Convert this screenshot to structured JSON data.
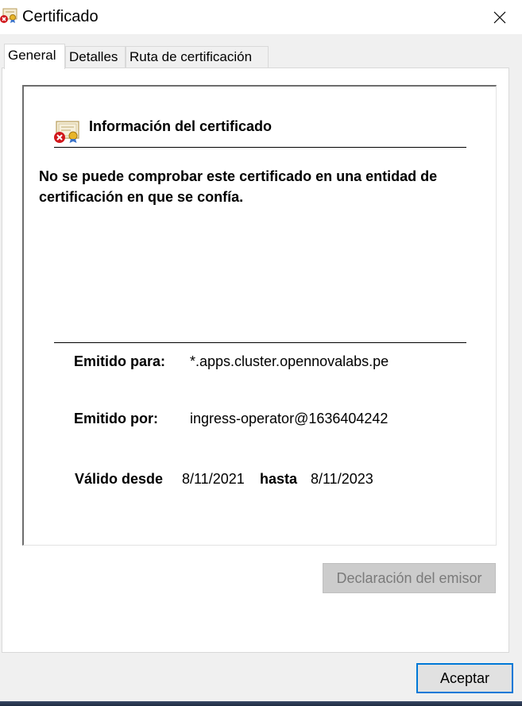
{
  "window": {
    "title": "Certificado",
    "close_glyph": "✕",
    "icon": "certificate-error-icon"
  },
  "tabs": [
    {
      "label": "General",
      "active": true
    },
    {
      "label": "Detalles",
      "active": false
    },
    {
      "label": "Ruta de certificación",
      "active": false
    }
  ],
  "info": {
    "icon": "certificate-error-icon",
    "title": "Información del certificado",
    "warning": "No se puede comprobar este certificado en una entidad de certificación en que se confía."
  },
  "fields": {
    "issued_to_label": "Emitido para:",
    "issued_to_value": "*.apps.cluster.opennovalabs.pe",
    "issued_by_label": "Emitido por:",
    "issued_by_value": "ingress-operator@1636404242",
    "valid_from_label": "Válido desde",
    "valid_from_value": "8/11/2021",
    "valid_to_label": "hasta",
    "valid_to_value": "8/11/2023"
  },
  "buttons": {
    "issuer_statement": "Declaración del emisor",
    "accept": "Aceptar"
  },
  "colors": {
    "accent_border": "#0078d7",
    "disabled_button": "#cccccc",
    "disabled_text": "#7a7a7a",
    "error_red": "#d0181c"
  }
}
